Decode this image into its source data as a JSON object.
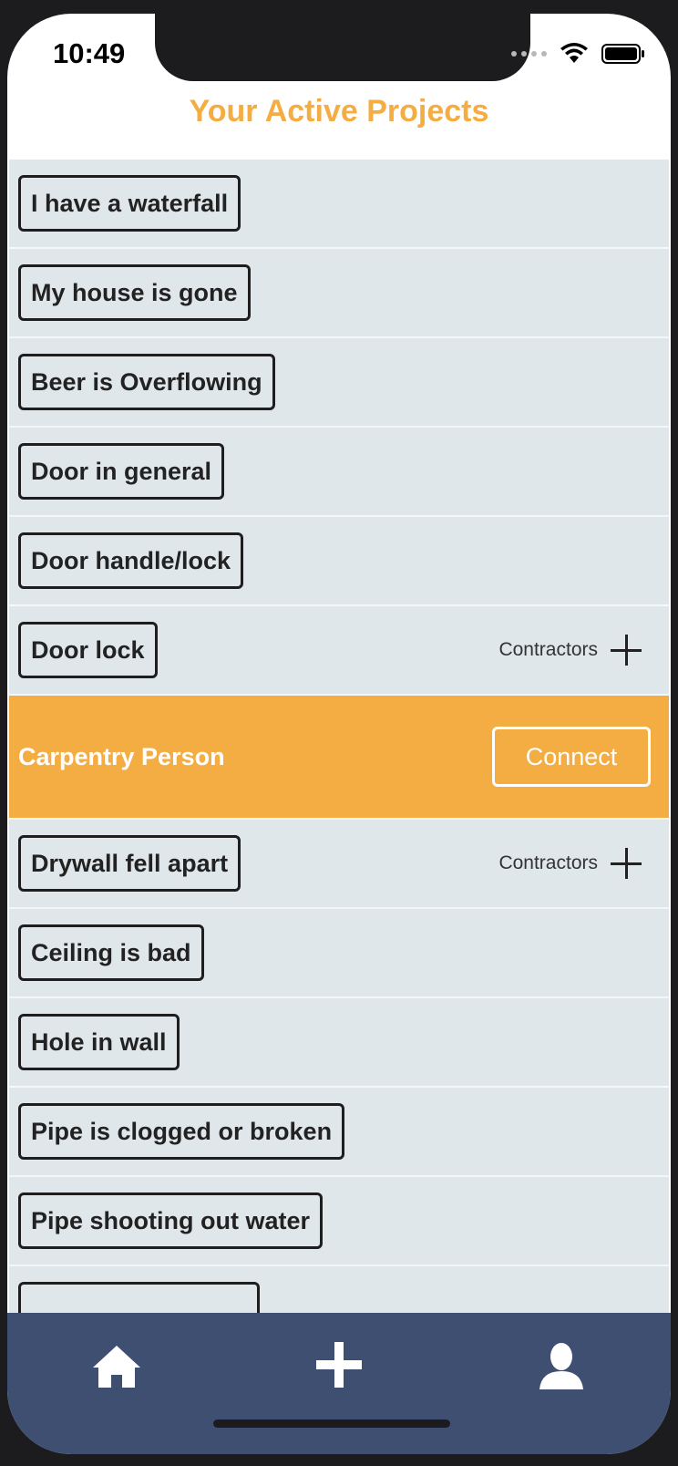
{
  "status_bar": {
    "time": "10:49"
  },
  "header": {
    "title": "Your Active Projects"
  },
  "projects": [
    {
      "label": "I have a waterfall"
    },
    {
      "label": "My house is gone"
    },
    {
      "label": "Beer is Overflowing"
    },
    {
      "label": "Door in general"
    },
    {
      "label": "Door handle/lock"
    },
    {
      "label": "Door lock",
      "contractors_label": "Contractors"
    },
    {
      "label": "Drywall fell apart",
      "contractors_label": "Contractors"
    },
    {
      "label": "Ceiling is bad"
    },
    {
      "label": "Hole in wall"
    },
    {
      "label": "Pipe is clogged or broken"
    },
    {
      "label": "Pipe shooting out water"
    },
    {
      "label": ""
    }
  ],
  "expanded_contractor": {
    "name": "Carpentry Person",
    "connect_label": "Connect"
  },
  "tabbar": {
    "items": [
      "home-icon",
      "plus-icon",
      "user-icon"
    ]
  },
  "colors": {
    "accent": "#f4ad42",
    "list_bg": "#e0e7eb",
    "tabbar_bg": "#3f4f72"
  }
}
